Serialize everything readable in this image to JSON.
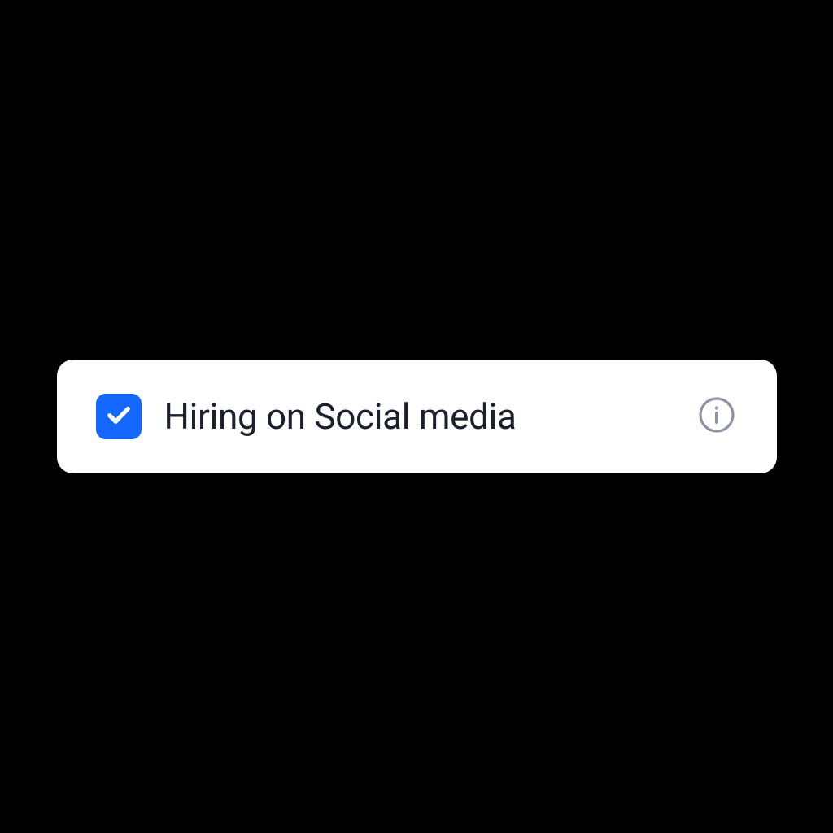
{
  "option": {
    "label": "Hiring on Social media",
    "checked": true
  },
  "colors": {
    "checkbox_bg": "#1568ff",
    "text": "#1a202c",
    "info_stroke": "#8b93a1"
  }
}
